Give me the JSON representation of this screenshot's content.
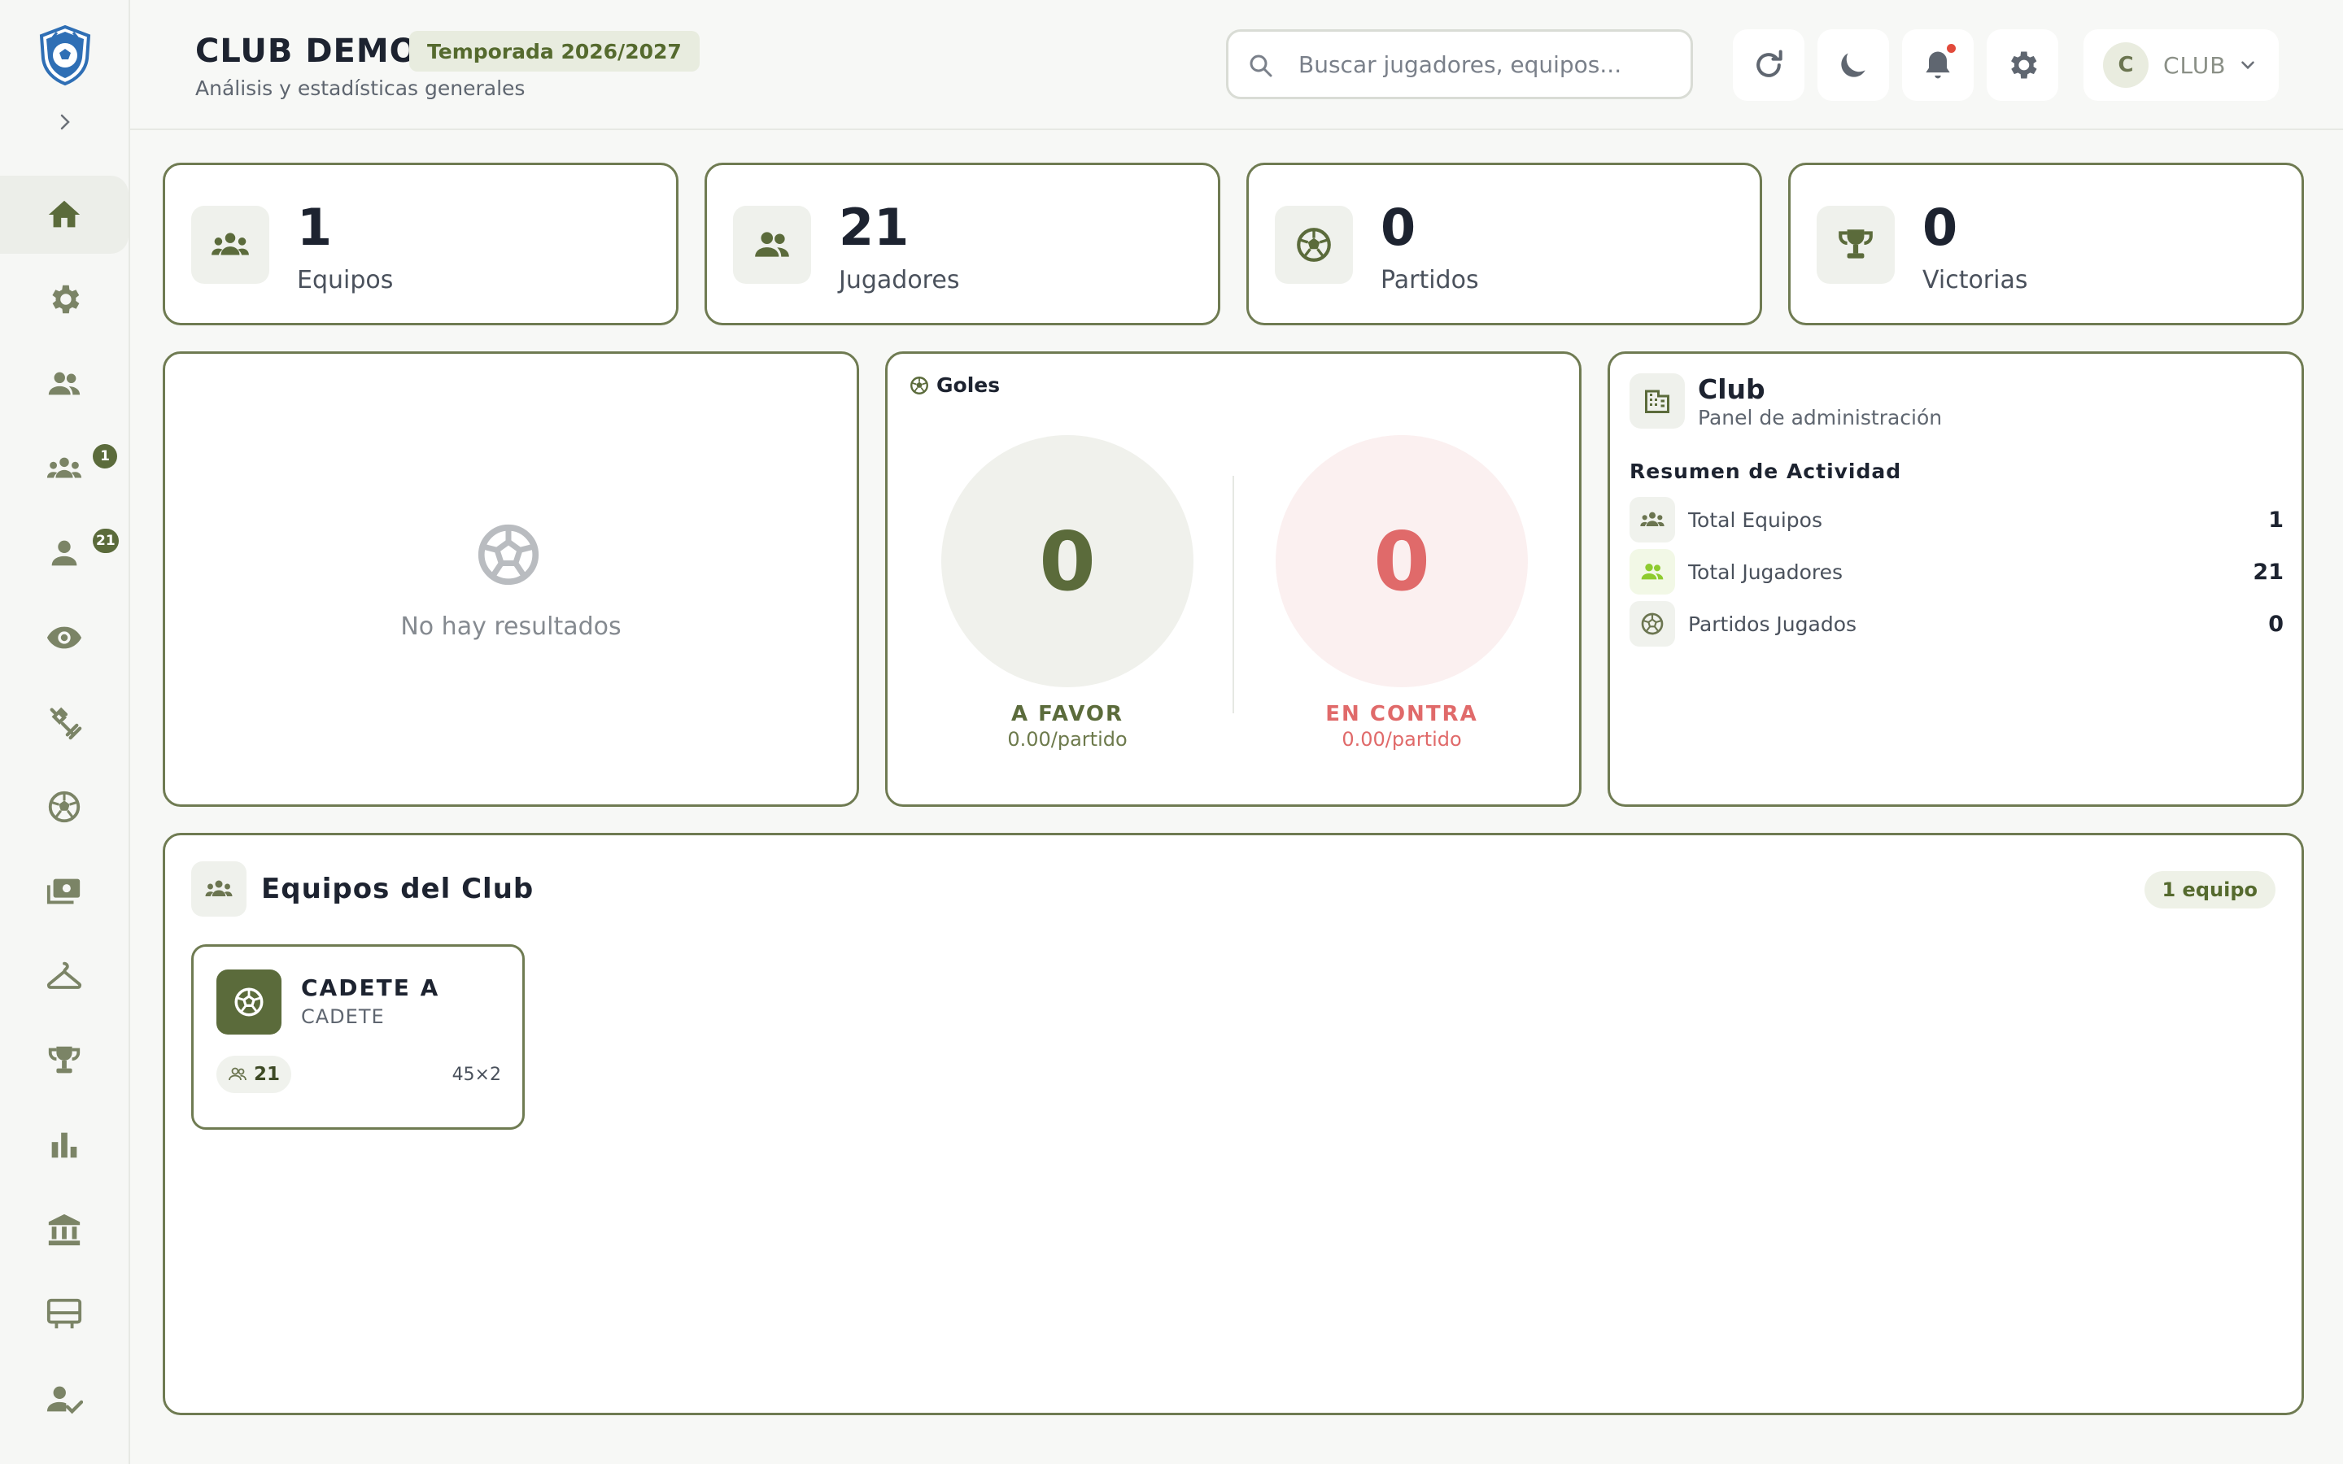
{
  "header": {
    "title": "CLUB DEMO",
    "season": "Temporada 2026/2027",
    "subtitle": "Análisis y estadísticas generales",
    "search_placeholder": "Buscar jugadores, equipos...",
    "user_initial": "C",
    "user_label": "CLUB"
  },
  "sidebar": {
    "badges": {
      "teams": "1",
      "players": "21"
    },
    "items": [
      "home-icon",
      "settings-icon",
      "users-icon",
      "teams-icon",
      "player-icon",
      "eye-icon",
      "training-icon",
      "ball-icon",
      "payments-icon",
      "equipment-icon",
      "trophy-icon",
      "stats-icon",
      "institution-icon",
      "board-icon",
      "attendance-icon"
    ]
  },
  "stats": [
    {
      "value": "1",
      "label": "Equipos",
      "icon": "teams-icon"
    },
    {
      "value": "21",
      "label": "Jugadores",
      "icon": "users-icon"
    },
    {
      "value": "0",
      "label": "Partidos",
      "icon": "ball-icon"
    },
    {
      "value": "0",
      "label": "Victorias",
      "icon": "trophy-icon"
    }
  ],
  "results": {
    "empty_text": "No hay resultados"
  },
  "goals": {
    "title": "Goles",
    "for_value": "0",
    "for_label": "A FAVOR",
    "for_avg": "0.00/partido",
    "against_value": "0",
    "against_label": "EN CONTRA",
    "against_avg": "0.00/partido"
  },
  "club": {
    "name": "Club",
    "subtitle": "Panel de administración",
    "summary_title": "Resumen de Actividad",
    "rows": [
      {
        "label": "Total Equipos",
        "value": "1"
      },
      {
        "label": "Total Jugadores",
        "value": "21"
      },
      {
        "label": "Partidos Jugados",
        "value": "0"
      }
    ]
  },
  "teams": {
    "title": "Equipos del Club",
    "count": "1 equipo",
    "items": [
      {
        "name": "CADETE A",
        "category": "CADETE",
        "players": "21",
        "format": "45×2"
      }
    ]
  },
  "colors": {
    "accent": "#5b6b3b",
    "border": "#6f7b52",
    "for": "#5b6b3b",
    "against": "#e06a6a"
  }
}
